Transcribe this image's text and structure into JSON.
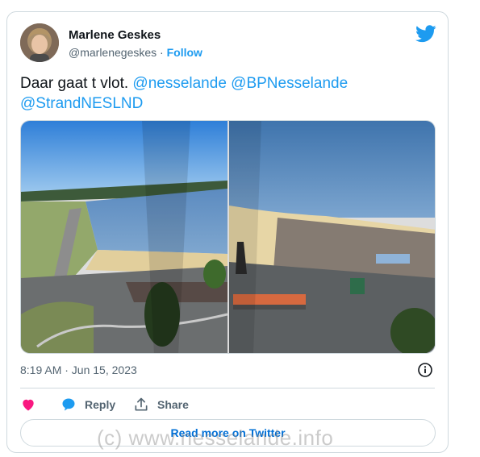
{
  "author": {
    "name": "Marlene Geskes",
    "handle": "@marlenegeskes",
    "separator": "·",
    "follow_label": "Follow"
  },
  "tweet": {
    "text_start": "Daar gaat t vlot.",
    "mentions": [
      "@nesselande",
      "@BPNesselande",
      "@StrandNESLND"
    ]
  },
  "timestamp": "8:19 AM · Jun 15, 2023",
  "actions": {
    "reply_label": "Reply",
    "share_label": "Share"
  },
  "read_more_label": "Read more on Twitter",
  "watermark": "(c)  www.nesselande.info",
  "colors": {
    "accent": "#1d9bf0",
    "like": "#f91880",
    "link": "#006fd6",
    "muted": "#536471",
    "border": "#cfd9de"
  },
  "icons": [
    "twitter-bird-icon",
    "info-icon",
    "heart-icon",
    "reply-bubble-icon",
    "share-icon"
  ]
}
